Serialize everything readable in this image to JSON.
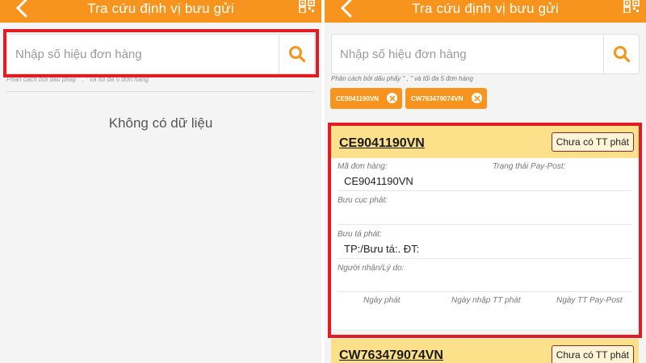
{
  "left": {
    "header": {
      "title": "Tra cứu định vị bưu gửi"
    },
    "search": {
      "placeholder": "Nhập số hiệu đơn hàng"
    },
    "hint": "Phân cách bởi dấu phẩy \" , \" và tối đa 5 đơn hàng",
    "empty_text": "Không có dữ liệu"
  },
  "right": {
    "header": {
      "title": "Tra cứu định vị bưu gửi"
    },
    "search": {
      "placeholder": "Nhập số hiệu đơn hàng"
    },
    "hint": "Phân cách bởi dấu phẩy \" , \" và tối đa 5 đơn hàng",
    "chips": [
      "CE9041190VN",
      "CW763479074VN"
    ],
    "card": {
      "code": "CE9041190VN",
      "status_button": "Chưa có TT phát",
      "order_label": "Mã đơn hàng:",
      "order_value": "CE9041190VN",
      "paypost_label": "Trạng thái Pay-Post:",
      "post_office_label": "Bưu cục phát:",
      "postman_label": "Bưu tá phát:",
      "postman_value": "TP:/Bưu tá:. ĐT:",
      "receiver_label": "Người nhận/Lý do:",
      "footer": [
        "Ngày phát",
        "Ngày nhập TT phát",
        "Ngày TT Pay-Post"
      ]
    },
    "card2": {
      "code": "CW763479074VN",
      "status_button": "Chưa có TT phát"
    }
  },
  "colors": {
    "accent": "#f7941d",
    "card_header": "#fde18a",
    "highlight": "#e31b23"
  },
  "icons": [
    "back-icon",
    "qr-code-icon",
    "search-icon",
    "close-icon"
  ]
}
